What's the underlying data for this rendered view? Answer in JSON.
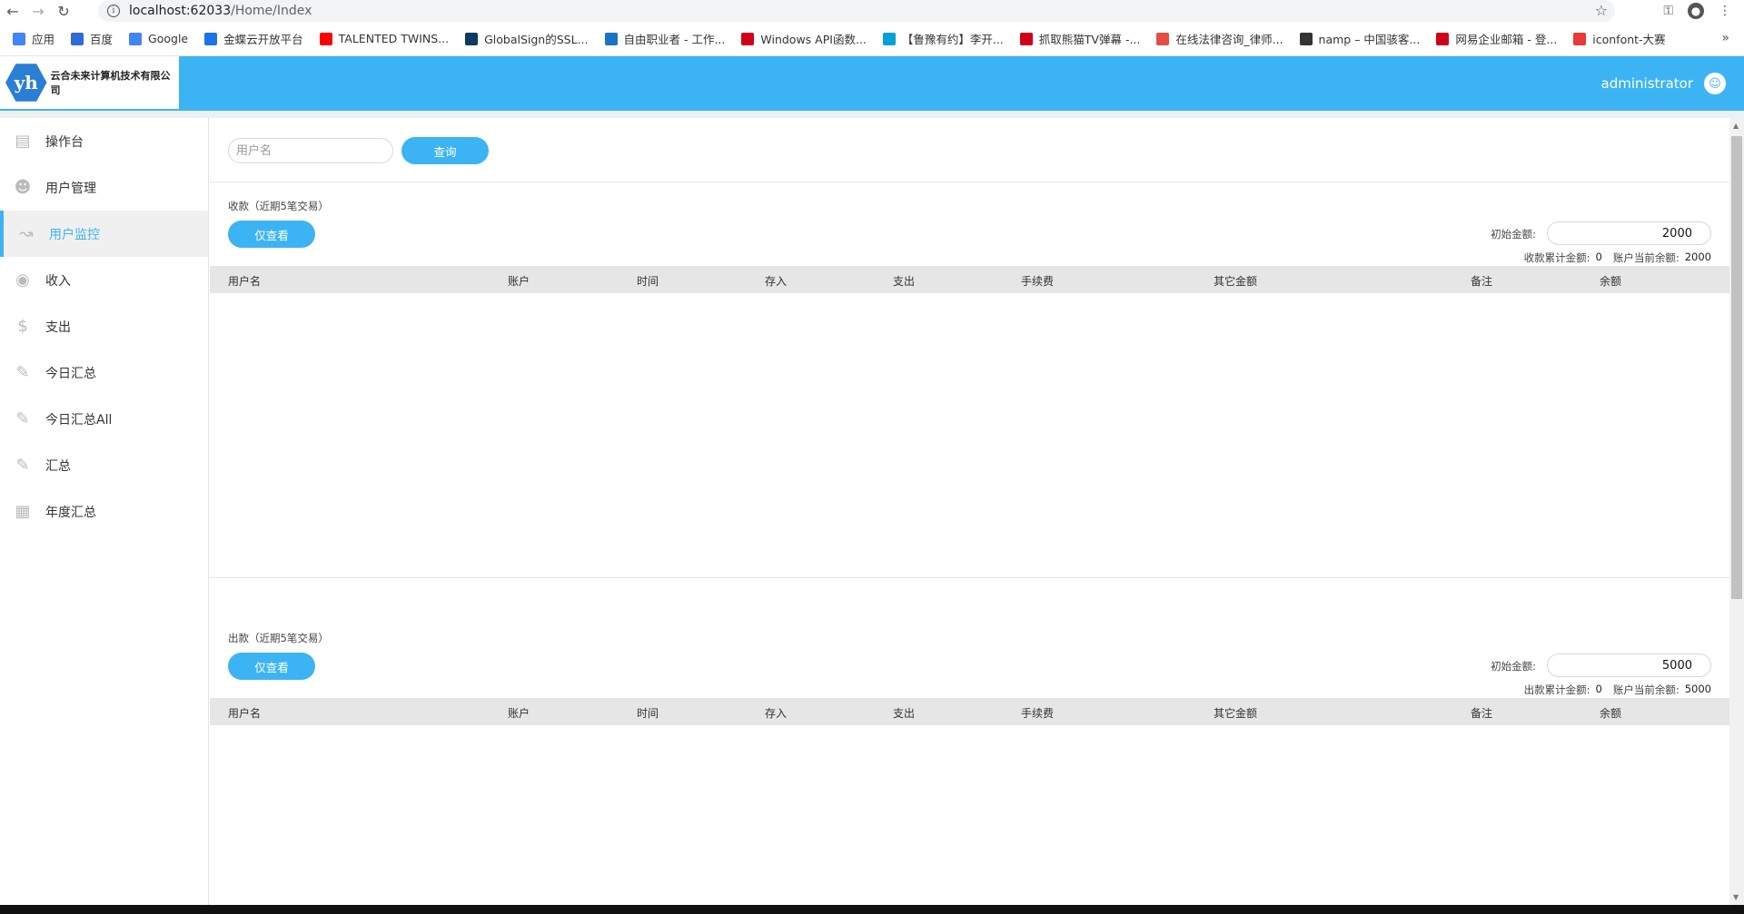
{
  "browser": {
    "url_host": "localhost:62033",
    "url_path": "/Home/Index",
    "bookmarks": [
      {
        "label": "应用",
        "color": "#4285f4"
      },
      {
        "label": "百度",
        "color": "#2f6ad9"
      },
      {
        "label": "Google",
        "color": "#4285f4"
      },
      {
        "label": "金蝶云开放平台",
        "color": "#1e73e8"
      },
      {
        "label": "TALENTED TWINS...",
        "color": "#ff0000"
      },
      {
        "label": "GlobalSign的SSL...",
        "color": "#0b3a63"
      },
      {
        "label": "自由职业者 - 工作...",
        "color": "#1a74c4"
      },
      {
        "label": "Windows API函数...",
        "color": "#d0021b"
      },
      {
        "label": "【鲁豫有约】李开...",
        "color": "#00a1d6"
      },
      {
        "label": "抓取熊猫TV弹幕 -...",
        "color": "#d0021b"
      },
      {
        "label": "在线法律咨询_律师...",
        "color": "#e54d42"
      },
      {
        "label": "namp – 中国骇客...",
        "color": "#333333"
      },
      {
        "label": "网易企业邮箱 - 登...",
        "color": "#d0021b"
      },
      {
        "label": "iconfont-大赛",
        "color": "#e73a3a"
      }
    ]
  },
  "header": {
    "logo_mark": "yh",
    "company": "云合未来计算机技术有限公司",
    "username": "administrator",
    "accent": "#3cb4f4"
  },
  "sidebar": {
    "items": [
      {
        "label": "操作台",
        "icon": "dashboard-icon"
      },
      {
        "label": "用户管理",
        "icon": "users-icon"
      },
      {
        "label": "用户监控",
        "icon": "monitor-chart-icon"
      },
      {
        "label": "收入",
        "icon": "coins-icon"
      },
      {
        "label": "支出",
        "icon": "dollar-icon"
      },
      {
        "label": "今日汇总",
        "icon": "edit-doc-icon"
      },
      {
        "label": "今日汇总All",
        "icon": "edit-doc-icon"
      },
      {
        "label": "汇总",
        "icon": "edit-doc-icon"
      },
      {
        "label": "年度汇总",
        "icon": "bar-board-icon"
      }
    ],
    "active_index": 2
  },
  "search": {
    "placeholder": "用户名",
    "query_label": "查询"
  },
  "columns": [
    "用户名",
    "账户",
    "时间",
    "存入",
    "支出",
    "手续费",
    "其它金额",
    "备注",
    "余额"
  ],
  "income": {
    "title": "收款（近期5笔交易）",
    "view_label": "仅查看",
    "init_label": "初始金额:",
    "init_value": "2000",
    "total_label": "收款累计金额:",
    "total_value": "0",
    "balance_label": "账户当前余额:",
    "balance_value": "2000"
  },
  "expense": {
    "title": "出款（近期5笔交易）",
    "view_label": "仅查看",
    "init_label": "初始金额:",
    "init_value": "5000",
    "total_label": "出款累计金额:",
    "total_value": "0",
    "balance_label": "账户当前余额:",
    "balance_value": "5000"
  }
}
